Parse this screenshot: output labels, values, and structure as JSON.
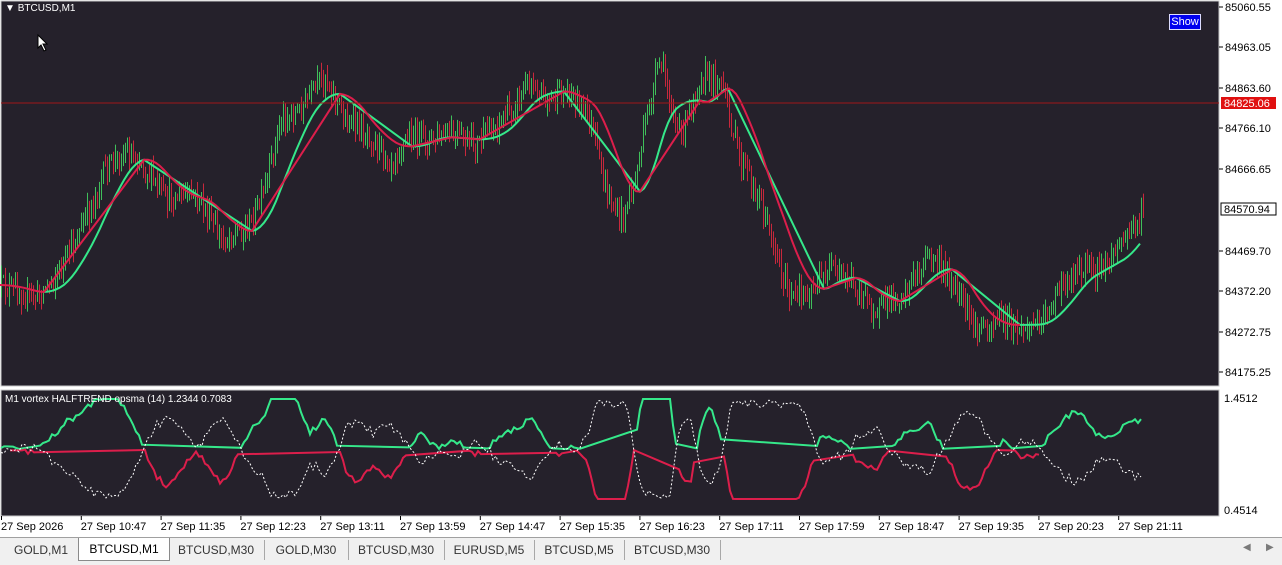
{
  "chart": {
    "symbol_title": "BTCUSD,M1",
    "subwindow_title": "M1 vortex HALFTREND opsma (14) 1.2344 0.7083",
    "show_button": "Show",
    "current_price": "84825.06",
    "bid_price": "84570.94",
    "price_ticks": [
      "85060.55",
      "84963.05",
      "84863.60",
      "84766.10",
      "84666.65",
      "84469.70",
      "84372.20",
      "84272.75",
      "84175.25"
    ],
    "indicator_ticks": [
      "1.4512",
      "0.4514"
    ],
    "time_ticks": [
      "27 Sep 2026",
      "27 Sep 10:47",
      "27 Sep 11:35",
      "27 Sep 12:23",
      "27 Sep 13:11",
      "27 Sep 13:59",
      "27 Sep 14:47",
      "27 Sep 15:35",
      "27 Sep 16:23",
      "27 Sep 17:11",
      "27 Sep 17:59",
      "27 Sep 18:47",
      "27 Sep 19:35",
      "27 Sep 20:23",
      "27 Sep 21:11"
    ],
    "colors": {
      "background": "#25212b",
      "bull_candle": "#3fbf5a",
      "bear_candle": "#c8283c",
      "trend_up": "#35e88a",
      "trend_down": "#dc1e4b",
      "current_price_line": "#a01818",
      "dotted_line": "#ffffff"
    }
  },
  "tabs": [
    {
      "label": "GOLD,M1",
      "active": false
    },
    {
      "label": "BTCUSD,M1",
      "active": true
    },
    {
      "label": "BTCUSD,M30",
      "active": false
    },
    {
      "label": "GOLD,M30",
      "active": false
    },
    {
      "label": "BTCUSD,M30",
      "active": false
    },
    {
      "label": "EURUSD,M5",
      "active": false
    },
    {
      "label": "BTCUSD,M5",
      "active": false
    },
    {
      "label": "BTCUSD,M30",
      "active": false
    }
  ]
}
